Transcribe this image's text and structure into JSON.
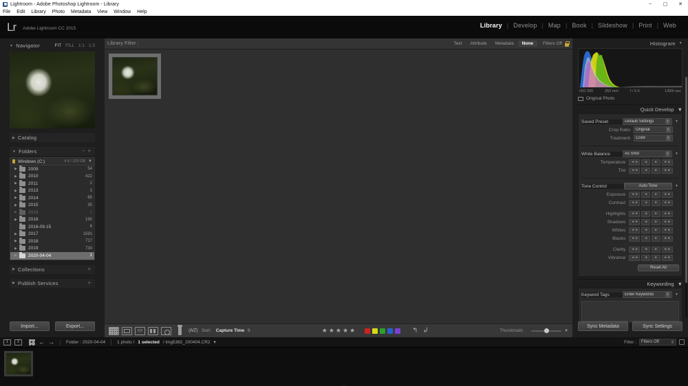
{
  "window": {
    "title": "Lightroom - Adobe Photoshop Lightroom - Library",
    "minimize": "−",
    "maximize": "▢",
    "close": "✕"
  },
  "menu": [
    "File",
    "Edit",
    "Library",
    "Photo",
    "Metadata",
    "View",
    "Window",
    "Help"
  ],
  "identity": {
    "logo": "Lr",
    "product": "Adobe Lightroom CC 2015"
  },
  "modules": [
    {
      "label": "Library",
      "active": true
    },
    {
      "label": "Develop",
      "active": false
    },
    {
      "label": "Map",
      "active": false
    },
    {
      "label": "Book",
      "active": false
    },
    {
      "label": "Slideshow",
      "active": false
    },
    {
      "label": "Print",
      "active": false
    },
    {
      "label": "Web",
      "active": false
    }
  ],
  "navigator": {
    "title": "Navigator",
    "modes": [
      {
        "label": "FIT",
        "on": true
      },
      {
        "label": "FILL",
        "on": false
      },
      {
        "label": "1:1",
        "on": false
      },
      {
        "label": "1:3",
        "on": false
      }
    ]
  },
  "catalog": {
    "title": "Catalog"
  },
  "folders": {
    "title": "Folders",
    "minus": "−",
    "plus": "+",
    "volume": {
      "name": "Windows (C:)",
      "free": "4.4 / 223 GB"
    },
    "items": [
      {
        "name": "2009",
        "count": "54",
        "selected": false,
        "dim": false,
        "expandable": true
      },
      {
        "name": "2010",
        "count": "422",
        "selected": false,
        "dim": false,
        "expandable": true
      },
      {
        "name": "2011",
        "count": "2",
        "selected": false,
        "dim": false,
        "expandable": true
      },
      {
        "name": "2013",
        "count": "3",
        "selected": false,
        "dim": false,
        "expandable": true
      },
      {
        "name": "2014",
        "count": "65",
        "selected": false,
        "dim": false,
        "expandable": true
      },
      {
        "name": "2015",
        "count": "35",
        "selected": false,
        "dim": false,
        "expandable": true
      },
      {
        "name": "2016",
        "count": "1",
        "selected": false,
        "dim": true,
        "expandable": true
      },
      {
        "name": "2016",
        "count": "190",
        "selected": false,
        "dim": false,
        "expandable": true
      },
      {
        "name": "2016-09-15",
        "count": "6",
        "selected": false,
        "dim": false,
        "expandable": false
      },
      {
        "name": "2017",
        "count": "1591",
        "selected": false,
        "dim": false,
        "expandable": true
      },
      {
        "name": "2018",
        "count": "717",
        "selected": false,
        "dim": false,
        "expandable": true
      },
      {
        "name": "2019",
        "count": "734",
        "selected": false,
        "dim": false,
        "expandable": true
      },
      {
        "name": "2020-04-04",
        "count": "1",
        "selected": true,
        "dim": false,
        "expandable": true
      }
    ]
  },
  "collections": {
    "title": "Collections",
    "plus": "+"
  },
  "publish": {
    "title": "Publish Services",
    "plus": "+"
  },
  "left_buttons": {
    "import": "Import...",
    "export": "Export..."
  },
  "library_filter": {
    "label": "Library Filter :",
    "options": [
      {
        "label": "Text",
        "on": false
      },
      {
        "label": "Attribute",
        "on": false
      },
      {
        "label": "Metadata",
        "on": false
      },
      {
        "label": "None",
        "on": true
      }
    ],
    "filters_state": "Filters Off",
    "lock_icon": "lock-icon"
  },
  "toolbar": {
    "view_icons": [
      "grid-view-icon",
      "loupe-view-icon",
      "compare-view-icon",
      "survey-view-icon",
      "people-view-icon"
    ],
    "paint_icon": "spray-can-icon",
    "sort_icon": "sort-az-icon",
    "sort_label": "Sort:",
    "sort_value": "Capture Time",
    "sort_caret": "⇅",
    "stars": "★★★★★",
    "color_labels": [
      "#cc2222",
      "#d8d819",
      "#2ca02c",
      "#2b5fd0",
      "#7d3fd4"
    ],
    "rotate_left": "↰",
    "rotate_right": "↲",
    "thumbnails_label": "Thumbnails",
    "thumbnails_caret": "▼"
  },
  "histogram": {
    "title": "Histogram",
    "iso": "ISO 200",
    "focal": "250 mm",
    "aperture": "f / 5.6",
    "shutter": "1/800 sec",
    "original_photo": "Original Photo"
  },
  "quick_develop": {
    "title": "Quick Develop",
    "saved_preset_label": "Saved Preset",
    "saved_preset_value": "Default Settings",
    "crop_ratio_label": "Crop Ratio",
    "crop_ratio_value": "Original",
    "treatment_label": "Treatment",
    "treatment_value": "Color",
    "white_balance_label": "White Balance",
    "white_balance_value": "As Shot",
    "temperature_label": "Temperature",
    "tint_label": "Tint",
    "tone_control_label": "Tone Control",
    "auto_tone": "Auto Tone",
    "reset_all": "Reset All",
    "tone_rows": [
      "Exposure",
      "Contrast",
      "Highlights",
      "Shadows",
      "Whites",
      "Blacks",
      "Clarity",
      "Vibrance"
    ],
    "step_back2": "◄◄",
    "step_back1": "◄",
    "step_fwd1": "►",
    "step_fwd2": "►►"
  },
  "keywording": {
    "title": "Keywording",
    "tags_label": "Keyword Tags",
    "tags_placeholder": "Enter Keywords"
  },
  "right_buttons": {
    "sync_metadata": "Sync Metadata",
    "sync_settings": "Sync Settings"
  },
  "filmstrip": {
    "page_1": "1",
    "page_2": "2",
    "grid_icon": "grid-icon",
    "back_arrow": "←",
    "forward_arrow": "→",
    "folder_label": "Folder : 2020-04-04",
    "photo_count": "1 photo /",
    "selected": "1 selected",
    "filename": "/ img5382_200404.CR2",
    "filename_caret": "▾",
    "filter_label": "Filter :",
    "filter_value": "Filters Off"
  },
  "colors": {
    "accent": "#c8a33a",
    "panel_bg": "#1e1e1e",
    "center_bg": "#2f2f2f",
    "selection": "#6d6d6d"
  }
}
